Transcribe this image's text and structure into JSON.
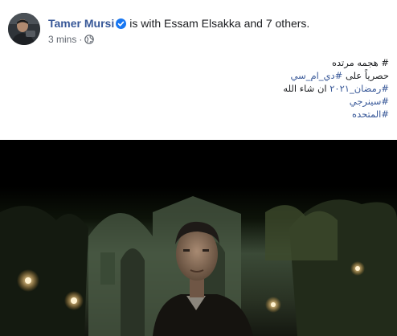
{
  "post": {
    "author": "Tamer Mursi",
    "with_text": "is with Essam Elsakka and 7 others.",
    "time": "3 mins",
    "separator": "·",
    "privacy_icon": "globe-icon",
    "verified_icon": "verified-badge-icon"
  },
  "post_text": {
    "line1": "# هجمه مرتده",
    "line2_prefix": "حصرياً على ",
    "line2_tag": "#دي_ام_سي",
    "line3_tag": "#رمضان_٢٠٢١",
    "line3_suffix": " ان شاء الله",
    "line4_tag": "#سينرجي",
    "line5_tag": "#المتحده"
  },
  "colors": {
    "link": "#385898",
    "text": "#1c1e21",
    "meta": "#616770"
  }
}
